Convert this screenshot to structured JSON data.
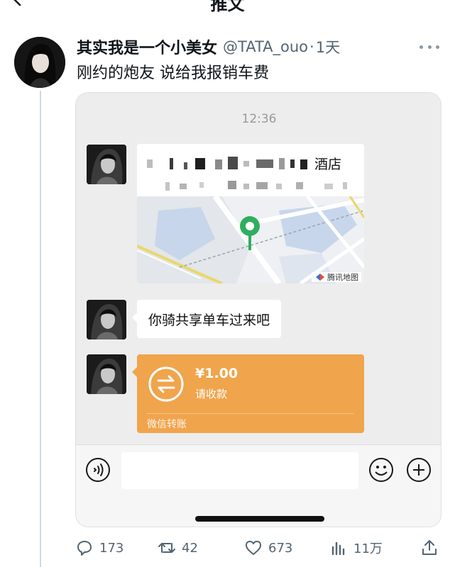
{
  "header": {
    "title": "推文"
  },
  "tweet": {
    "display_name": "其实我是一个小美女",
    "handle": "@TATA_ouo",
    "separator": "·",
    "time": "1天",
    "text": "刚约的炮友 说给我报销车费"
  },
  "chat": {
    "time": "12:36",
    "location": {
      "name_suffix": "酒店",
      "map_brand": "腾讯地图"
    },
    "message": "你骑共享单车过来吧",
    "transfer": {
      "amount": "¥1.00",
      "status": "请收款",
      "footer": "微信转账"
    }
  },
  "actions": {
    "replies": "173",
    "retweets": "42",
    "likes": "673",
    "views": "11万"
  },
  "colors": {
    "transfer_orange": "#f0a44c",
    "map_pin_green": "#2fae5f",
    "chat_background": "#ededed",
    "secondary_text": "#536471"
  }
}
